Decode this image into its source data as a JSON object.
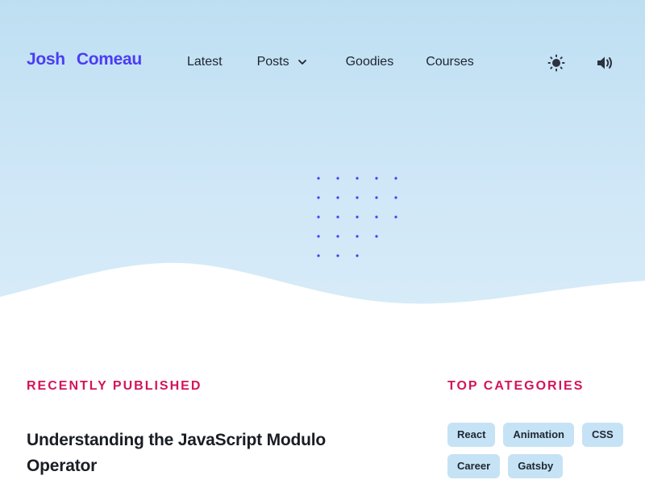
{
  "header": {
    "logo_first": "Josh",
    "logo_last": "Comeau",
    "nav": {
      "latest": "Latest",
      "posts": "Posts",
      "goodies": "Goodies",
      "courses": "Courses"
    },
    "icons": [
      "sun-icon",
      "speaker-icon"
    ]
  },
  "colors": {
    "brand": "#4b3cf5",
    "accent": "#d4145a",
    "hero_bg": "#cfe7f7",
    "tag_bg": "#c5e3f5",
    "dot": "#4b3cf5"
  },
  "recent": {
    "label": "Recently Published",
    "post_title": "Understanding the JavaScript Modulo Operator"
  },
  "categories": {
    "label": "Top Categories",
    "tags": [
      "React",
      "Animation",
      "CSS",
      "Career",
      "Gatsby"
    ]
  }
}
